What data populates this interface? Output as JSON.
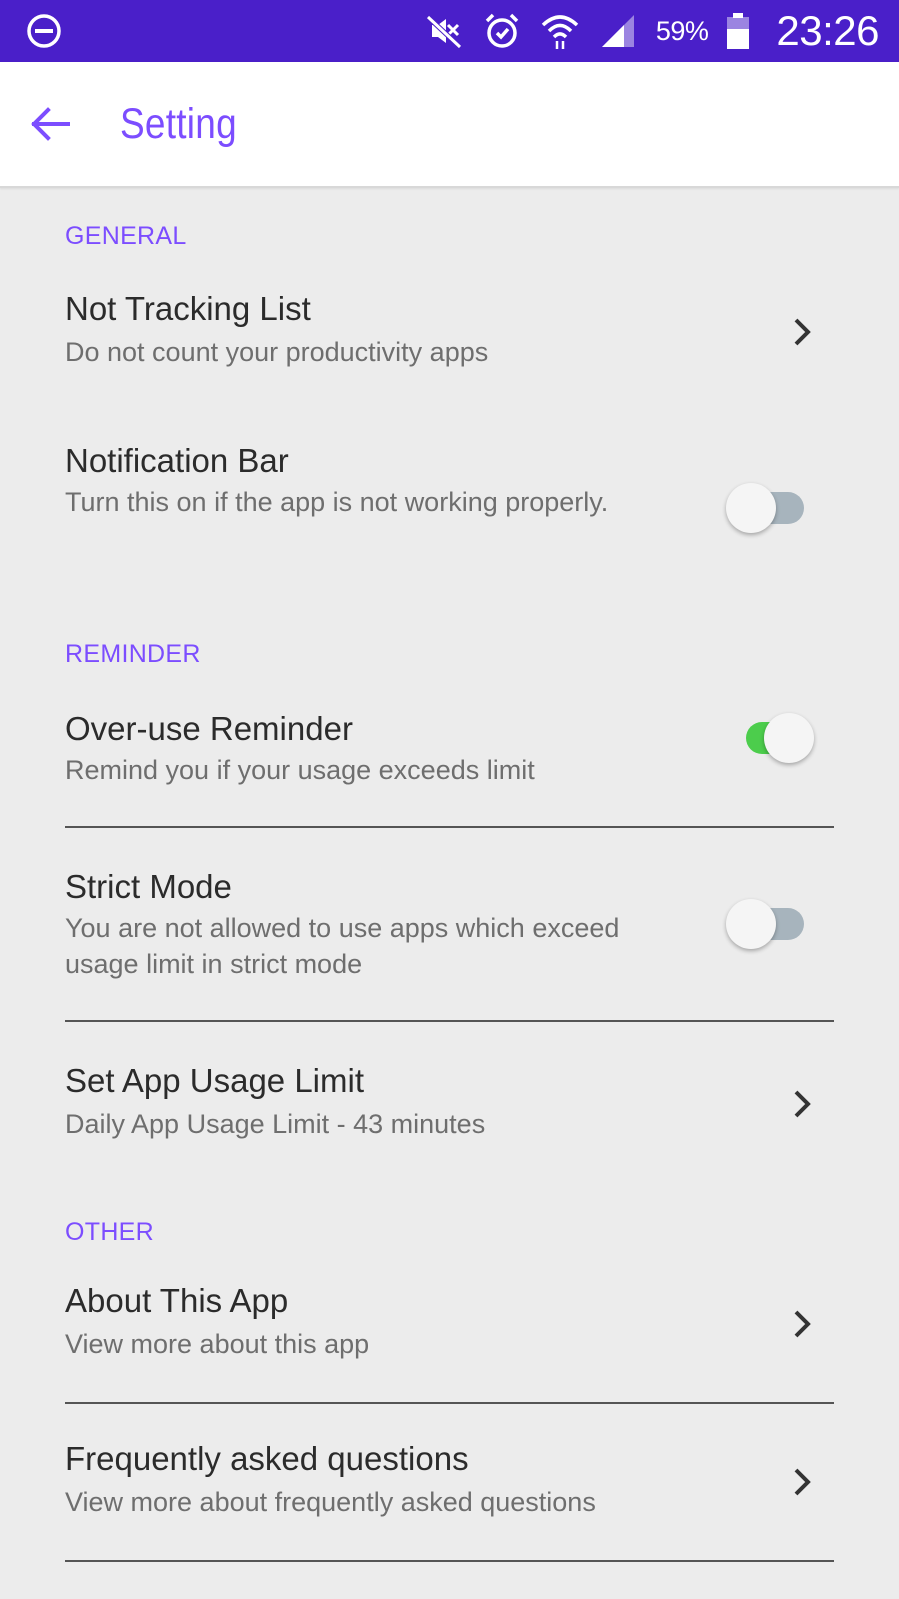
{
  "status_bar": {
    "battery_percent": "59%",
    "time": "23:26",
    "icons": [
      "dnd-icon",
      "mute-icon",
      "alarm-icon",
      "wifi-icon",
      "signal-icon",
      "battery-icon"
    ]
  },
  "app_bar": {
    "title": "Setting",
    "back_icon": "back-arrow-icon"
  },
  "colors": {
    "status_bar": "#4a1fc9",
    "accent": "#7c4dff",
    "toggle_on": "#4ccd4c",
    "toggle_off_track": "#a7b4bd",
    "background": "#ececec"
  },
  "sections": {
    "general": {
      "header": "GENERAL",
      "not_tracking": {
        "title": "Not Tracking List",
        "subtitle": "Do not count your productivity apps"
      },
      "notification_bar": {
        "title": "Notification Bar",
        "subtitle": "Turn this on if the app is not working properly.",
        "enabled": false
      }
    },
    "reminder": {
      "header": "REMINDER",
      "overuse": {
        "title": "Over-use Reminder",
        "subtitle": "Remind you if your usage exceeds limit",
        "enabled": true
      },
      "strict_mode": {
        "title": "Strict Mode",
        "subtitle": "You are not allowed to use apps which exceed usage limit in strict mode",
        "enabled": false
      },
      "usage_limit": {
        "title": "Set App Usage Limit",
        "subtitle": "Daily App Usage Limit - 43 minutes"
      }
    },
    "other": {
      "header": "OTHER",
      "about": {
        "title": "About This App",
        "subtitle": "View more about this app"
      },
      "faq": {
        "title": "Frequently asked questions",
        "subtitle": "View more about frequently asked questions"
      }
    }
  }
}
